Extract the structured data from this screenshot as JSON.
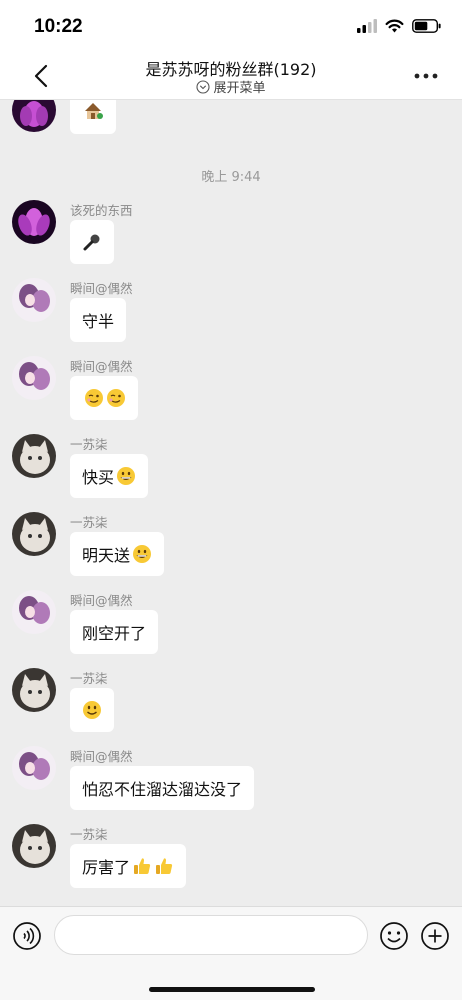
{
  "status_bar": {
    "time": "10:22",
    "icons": [
      "signal-icon",
      "wifi-icon",
      "battery-icon"
    ]
  },
  "header": {
    "title": "是苏苏呀的粉丝群(192)",
    "subtitle": "展开菜单"
  },
  "colors": {
    "bubble": "#ffffff",
    "background": "#ededed",
    "meta_text": "#8a8a8a"
  },
  "chat": {
    "partial_message": {
      "icon": "house-emoji-icon"
    },
    "time_separator": "晚上 9:44",
    "messages": [
      {
        "sender": "该死的东西",
        "avatar": "lotus-avatar",
        "text": "",
        "emojis": [
          "microphone-icon"
        ]
      },
      {
        "sender": "瞬间@偶然",
        "avatar": "anime-avatar",
        "text": "守半",
        "emojis": []
      },
      {
        "sender": "瞬间@偶然",
        "avatar": "anime-avatar",
        "text": "",
        "emojis": [
          "wink-emoji",
          "wink-emoji"
        ]
      },
      {
        "sender": "一苏柒",
        "avatar": "cat-avatar",
        "text": "快买",
        "emojis": [
          "grin-emoji"
        ]
      },
      {
        "sender": "一苏柒",
        "avatar": "cat-avatar",
        "text": "明天送",
        "emojis": [
          "grin-emoji"
        ]
      },
      {
        "sender": "瞬间@偶然",
        "avatar": "anime-avatar",
        "text": "刚空开了",
        "emojis": []
      },
      {
        "sender": "一苏柒",
        "avatar": "cat-avatar",
        "text": "",
        "emojis": [
          "smile-emoji"
        ]
      },
      {
        "sender": "瞬间@偶然",
        "avatar": "anime-avatar",
        "text": "怕忍不住溜达溜达没了",
        "emojis": []
      },
      {
        "sender": "一苏柒",
        "avatar": "cat-avatar",
        "text": "厉害了",
        "emojis": [
          "thumbs-up-emoji",
          "thumbs-up-emoji"
        ]
      }
    ]
  },
  "input_bar": {
    "value": "",
    "placeholder": "",
    "icons": [
      "voice-icon",
      "emoji-icon",
      "plus-icon"
    ]
  }
}
